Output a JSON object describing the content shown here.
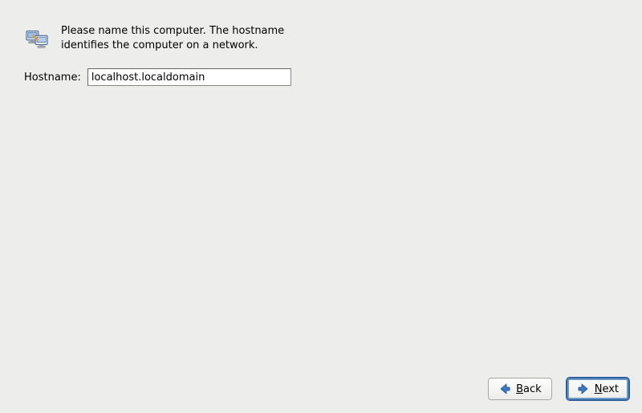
{
  "instructions": "Please name this computer.  The hostname identifies the computer on a network.",
  "hostname_label": "Hostname:",
  "hostname_value": "localhost.localdomain",
  "buttons": {
    "back": {
      "prefix": "",
      "mnemonic": "B",
      "suffix": "ack"
    },
    "next": {
      "prefix": "",
      "mnemonic": "N",
      "suffix": "ext"
    }
  }
}
